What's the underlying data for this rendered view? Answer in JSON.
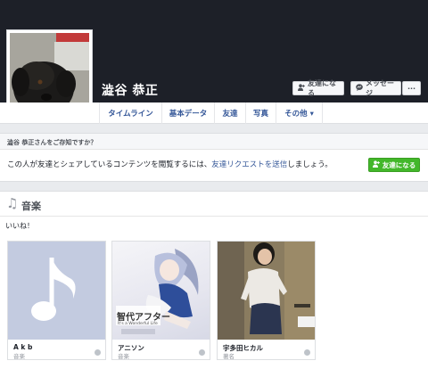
{
  "profile": {
    "name": "澁谷 恭正"
  },
  "header_buttons": {
    "add_friend": "友達になる",
    "message": "メッセージ",
    "more": "···"
  },
  "nav": {
    "tabs": [
      "タイムライン",
      "基本データ",
      "友達",
      "写真",
      "その他 ▾"
    ]
  },
  "know_card": {
    "heading": "澁谷 恭正さんをご存知ですか？",
    "text_before": "この人が友達とシェアしているコンテンツを閲覧するには、",
    "link": "友達リクエストを送信",
    "text_after": "しましょう。",
    "button": "友達になる"
  },
  "music": {
    "title": "音楽",
    "likes_label": "いいね！",
    "items": [
      {
        "name": "A k b",
        "category": "音楽"
      },
      {
        "name": "アニソン",
        "category": "音楽"
      },
      {
        "name": "宇多田ヒカル",
        "category": "著名"
      }
    ]
  },
  "anime_art_text": "智代アフター",
  "anime_art_sub": "It's a Wonderful Life",
  "colors": {
    "cover": "#1d2028",
    "link": "#365899",
    "green_button": "#42b72a",
    "note_tile": "#c3cbe0"
  }
}
